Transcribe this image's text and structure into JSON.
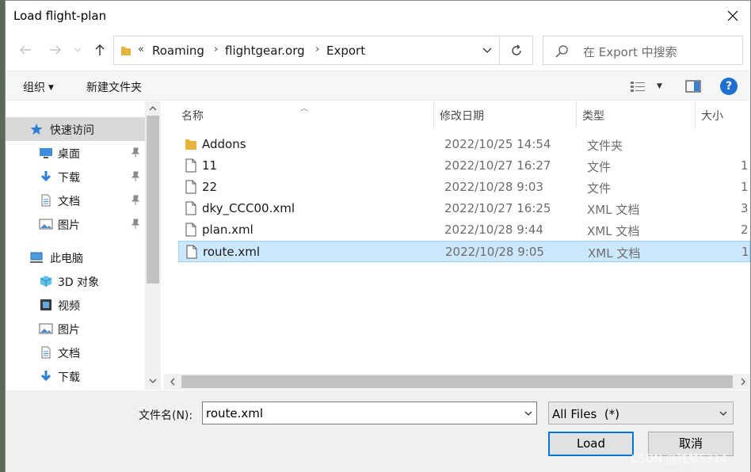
{
  "title": "Load flight-plan",
  "address": {
    "overflow": "«",
    "segments": [
      "Roaming",
      "flightgear.org",
      "Export"
    ]
  },
  "search": {
    "placeholder": "在 Export 中搜索"
  },
  "toolbar": {
    "organize": "组织",
    "new_folder": "新建文件夹",
    "help": "?"
  },
  "nav": {
    "quick_access": "快速访问",
    "desktop": "桌面",
    "downloads": "下载",
    "documents": "文档",
    "pictures": "图片",
    "this_pc": "此电脑",
    "objects3d": "3D 对象",
    "videos": "视频",
    "pc_pictures": "图片",
    "pc_documents": "文档",
    "pc_downloads": "下载"
  },
  "columns": {
    "name": "名称",
    "date": "修改日期",
    "type": "类型",
    "size": "大小"
  },
  "files": [
    {
      "name": "Addons",
      "date": "2022/10/25 14:54",
      "type": "文件夹",
      "size": "",
      "icon": "folder-icon"
    },
    {
      "name": "11",
      "date": "2022/10/27 16:27",
      "type": "文件",
      "size": "1",
      "icon": "file-icon"
    },
    {
      "name": "22",
      "date": "2022/10/28 9:03",
      "type": "文件",
      "size": "1",
      "icon": "file-icon"
    },
    {
      "name": "dky_CCC00.xml",
      "date": "2022/10/27 16:25",
      "type": "XML 文档",
      "size": "3",
      "icon": "file-icon"
    },
    {
      "name": "plan.xml",
      "date": "2022/10/28 9:44",
      "type": "XML 文档",
      "size": "2",
      "icon": "file-icon"
    },
    {
      "name": "route.xml",
      "date": "2022/10/28 9:05",
      "type": "XML 文档",
      "size": "1",
      "icon": "file-icon"
    }
  ],
  "bottom": {
    "filename_label": "文件名(N):",
    "filename_value": "route.xml",
    "filetype": "All Files  (*)",
    "load": "Load",
    "cancel": "取消"
  },
  "watermark": "CSDN @残梦5314",
  "colors": {
    "selection": "#cce8ff",
    "accent": "#0078d7",
    "help": "#1f6fd1",
    "folder": "#e8b53c"
  }
}
